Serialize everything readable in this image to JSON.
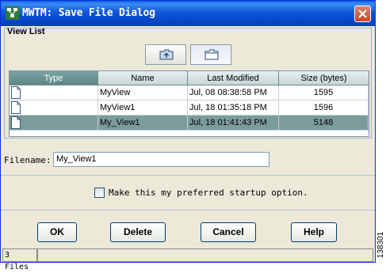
{
  "window": {
    "title": "MWTM: Save File Dialog"
  },
  "view_list": {
    "label": "View List",
    "columns": [
      "Type",
      "Name",
      "Last Modified",
      "Size (bytes)"
    ],
    "rows": [
      {
        "type_icon": "document-icon",
        "name": "MyView",
        "modified": "Jul, 08 08:38:58 PM",
        "size": "1595"
      },
      {
        "type_icon": "document-icon",
        "name": "MyView1",
        "modified": "Jul, 18 01:35:18 PM",
        "size": "1596"
      },
      {
        "type_icon": "document-icon",
        "name": "My_View1",
        "modified": "Jul, 18 01:41:43 PM",
        "size": "5148",
        "selected": true
      }
    ],
    "toolbar_icons": [
      "up-folder-icon",
      "new-folder-icon"
    ]
  },
  "filename": {
    "label": "Filename:",
    "value": "My_View1"
  },
  "startup_option": {
    "label": "Make this my preferred startup option.",
    "checked": false
  },
  "buttons": {
    "ok": "OK",
    "delete": "Delete",
    "cancel": "Cancel",
    "help": "Help"
  },
  "status": {
    "files": "3 Files"
  },
  "figure_number": "138301",
  "colors": {
    "title_bar": "#0a52d6",
    "selected_row": "#7c9c9c",
    "sorted_header": "#6b9393",
    "close_button": "#d4573c"
  }
}
